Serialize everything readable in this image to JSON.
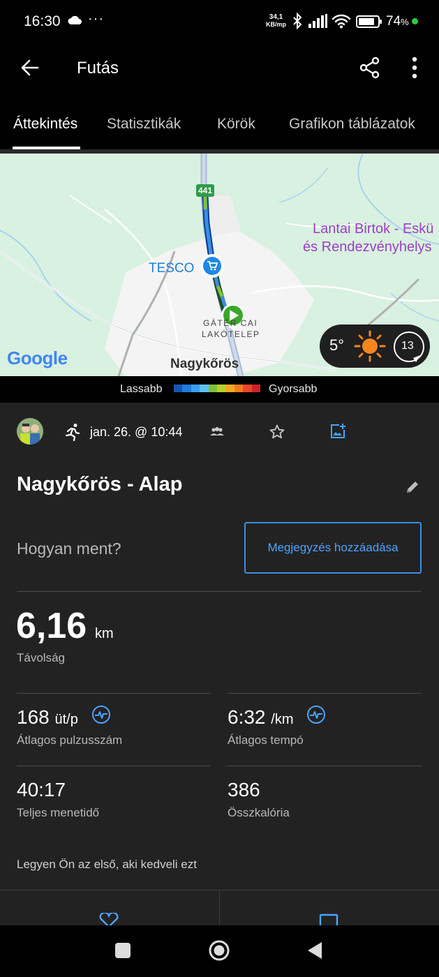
{
  "status_bar": {
    "time": "16:30",
    "net_speed_value": "34,1",
    "net_speed_unit": "KB/mp",
    "battery_percent": "74",
    "battery_symbol": "%",
    "icons": [
      "cloud-icon",
      "more-dots-icon",
      "bluetooth-icon",
      "signal-icon",
      "wifi-icon",
      "battery-icon"
    ]
  },
  "app_bar": {
    "title": "Futás",
    "icons": [
      "back-arrow-icon",
      "share-icon",
      "more-vert-icon"
    ]
  },
  "tabs": [
    {
      "label": "Áttekintés",
      "active": true
    },
    {
      "label": "Statisztikák",
      "active": false
    },
    {
      "label": "Körök",
      "active": false
    },
    {
      "label": "Grafikon táblázatok",
      "active": false
    }
  ],
  "map": {
    "road_number": "441",
    "poi_tesco": "TESCO",
    "poi_estate_line1": "Lantai Birtok - Eskü",
    "poi_estate_line2": "és Rendezvényhelys",
    "district_line1": "GÁTÉR CAI",
    "district_line2": "LAKÓTELEP",
    "town": "Nagykőrös",
    "google": "Google",
    "weather_temp": "5°",
    "weather_wind": "13"
  },
  "speed_legend": {
    "slower": "Lassabb",
    "faster": "Gyorsabb",
    "colors": [
      "#1557b0",
      "#1f7be0",
      "#3aa0f0",
      "#5fc0f0",
      "#7ec23a",
      "#b7d22a",
      "#f5a623",
      "#f07a22",
      "#e8452c",
      "#d0202a"
    ]
  },
  "activity": {
    "date": "jan. 26. @ 10:44",
    "title": "Nagykőrös - Alap",
    "how_prompt": "Hogyan ment?",
    "add_note_button": "Megjegyzés hozzáadása",
    "distance_value": "6,16",
    "distance_unit": "km",
    "distance_label": "Távolság",
    "stats": [
      {
        "value": "168",
        "unit": "üt/p",
        "label": "Átlagos pulzusszám",
        "has_chart_icon": true
      },
      {
        "value": "6:32",
        "unit": "/km",
        "label": "Átlagos tempó",
        "has_chart_icon": true
      },
      {
        "value": "40:17",
        "unit": "",
        "label": "Teljes menetidő",
        "has_chart_icon": false
      },
      {
        "value": "386",
        "unit": "",
        "label": "Összkalória",
        "has_chart_icon": false
      }
    ],
    "like_text": "Legyen Ön az első, aki kedveli ezt"
  },
  "colors": {
    "accent_blue": "#3d8fe0",
    "content_bg": "#222222",
    "route_green": "#7ec23a",
    "start_marker": "#3aa829"
  }
}
